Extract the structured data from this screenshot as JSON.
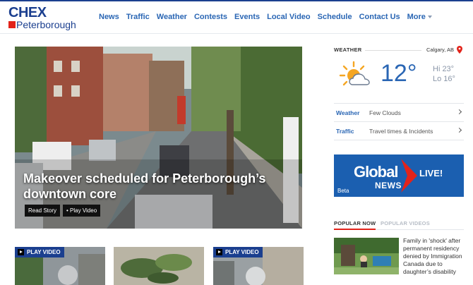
{
  "brand": {
    "logo_top": "CHEX",
    "logo_bottom": "Peterborough",
    "accent": "#1b3f8f",
    "red": "#e2231a"
  },
  "nav": {
    "items": [
      "News",
      "Traffic",
      "Weather",
      "Contests",
      "Events",
      "Local Video",
      "Schedule",
      "Contact Us"
    ],
    "more_label": "More"
  },
  "hero": {
    "title": "Makeover scheduled for Peterborough’s downtown core",
    "read_story": "Read Story",
    "play_video": "• Play Video"
  },
  "thumbs": [
    {
      "label": "PLAY VIDEO"
    },
    {
      "label": ""
    },
    {
      "label": "PLAY VIDEO"
    }
  ],
  "weather": {
    "header": "WEATHER",
    "location": "Calgary, AB",
    "icon": "partly-cloudy-icon",
    "temp": "12°",
    "hi": "Hi 23°",
    "lo": "Lo 16°",
    "rows": [
      {
        "key": "Weather",
        "value": "Few Clouds"
      },
      {
        "key": "Traffic",
        "value": "Travel times & Incidents"
      }
    ]
  },
  "global_news": {
    "global": "Global",
    "news": "NEWS",
    "live": "LIVE!",
    "beta": "Beta"
  },
  "popular": {
    "tab_active": "POPULAR NOW",
    "tab_inactive": "POPULAR VIDEOS",
    "item_text": "Family in 'shock' after permanent residency denied by Immigration Canada due to daughter’s disability"
  }
}
